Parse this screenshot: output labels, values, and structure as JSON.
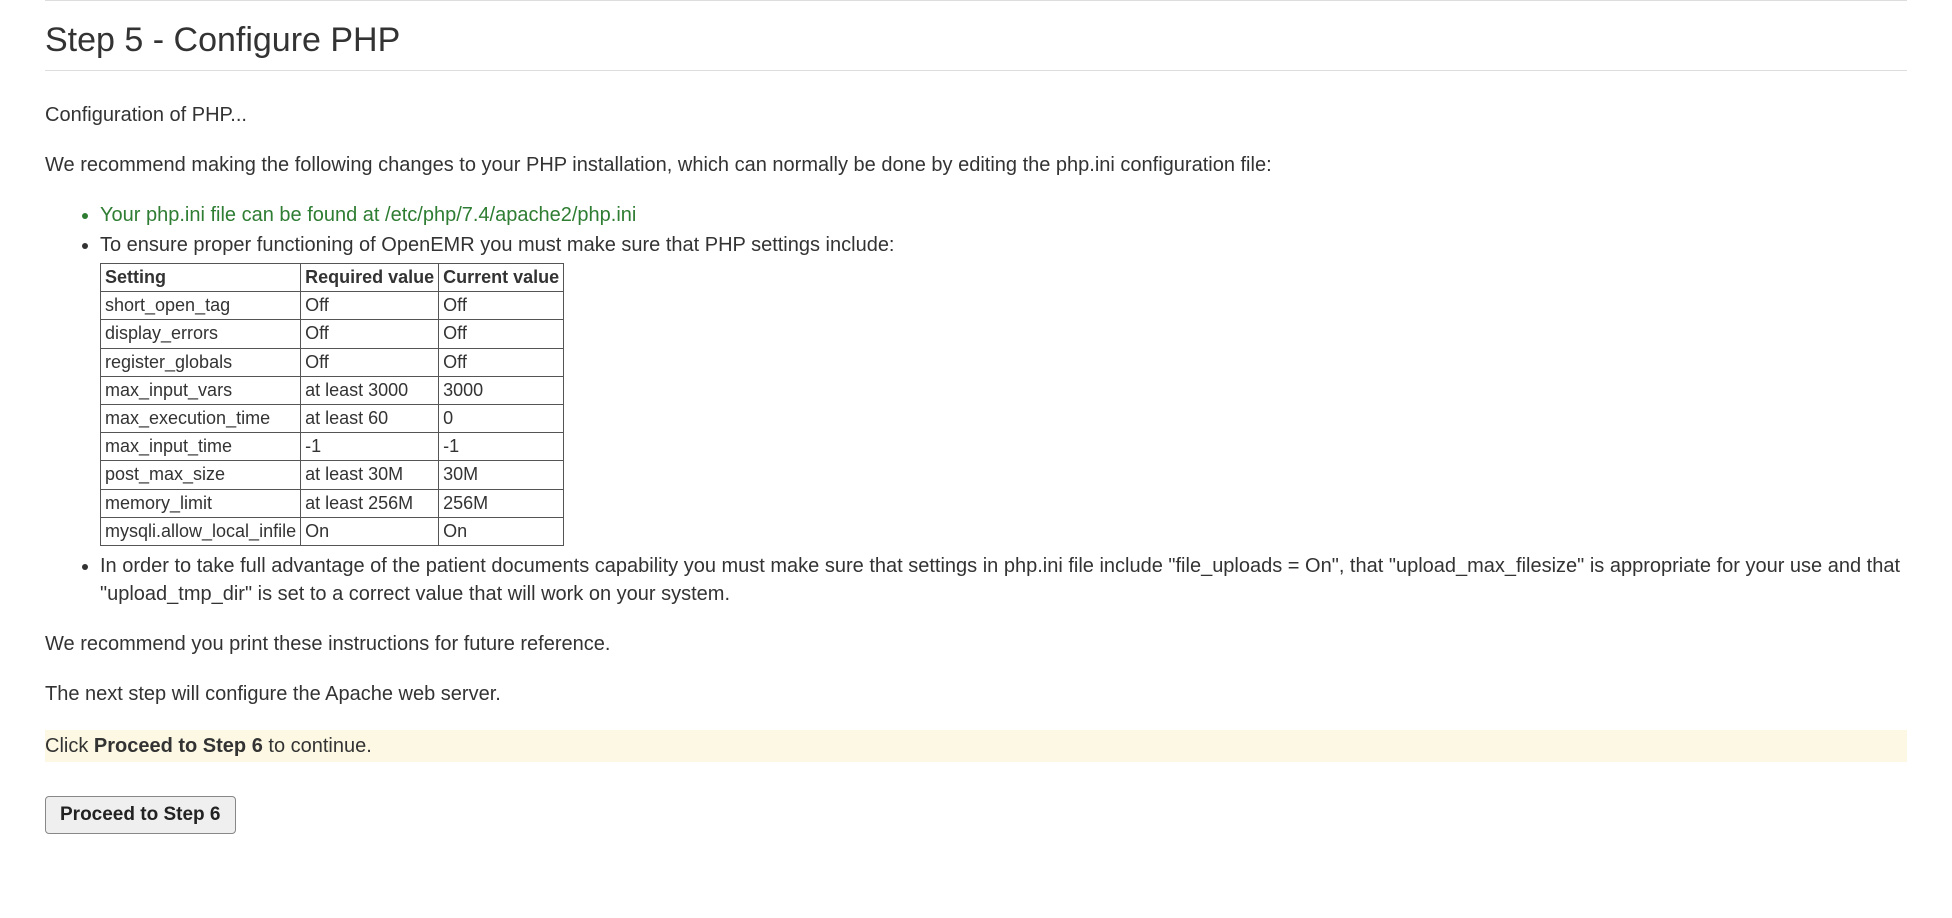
{
  "title": "Step 5 - Configure PHP",
  "intro": "Configuration of PHP...",
  "recommend": "We recommend making the following changes to your PHP installation, which can normally be done by editing the php.ini configuration file:",
  "bullets": {
    "phpini_location": "Your php.ini file can be found at /etc/php/7.4/apache2/php.ini",
    "ensure_intro": "To ensure proper functioning of OpenEMR you must make sure that PHP settings include:",
    "uploads_note": "In order to take full advantage of the patient documents capability you must make sure that settings in php.ini file include \"file_uploads = On\", that \"upload_max_filesize\" is appropriate for your use and that \"upload_tmp_dir\" is set to a correct value that will work on your system."
  },
  "table": {
    "headers": {
      "setting": "Setting",
      "required": "Required value",
      "current": "Current value"
    },
    "rows": [
      {
        "setting": "short_open_tag",
        "required": "Off",
        "current": "Off"
      },
      {
        "setting": "display_errors",
        "required": "Off",
        "current": "Off"
      },
      {
        "setting": "register_globals",
        "required": "Off",
        "current": "Off"
      },
      {
        "setting": "max_input_vars",
        "required": "at least 3000",
        "current": "3000"
      },
      {
        "setting": "max_execution_time",
        "required": "at least 60",
        "current": "0"
      },
      {
        "setting": "max_input_time",
        "required": "-1",
        "current": "-1"
      },
      {
        "setting": "post_max_size",
        "required": "at least 30M",
        "current": "30M"
      },
      {
        "setting": "memory_limit",
        "required": "at least 256M",
        "current": "256M"
      },
      {
        "setting": "mysqli.allow_local_infile",
        "required": "On",
        "current": "On"
      }
    ]
  },
  "print_note": "We recommend you print these instructions for future reference.",
  "next_step_note": "The next step will configure the Apache web server.",
  "continue_bar": {
    "prefix": "Click ",
    "bold": "Proceed to Step 6",
    "suffix": " to continue."
  },
  "proceed_button": "Proceed to Step 6"
}
